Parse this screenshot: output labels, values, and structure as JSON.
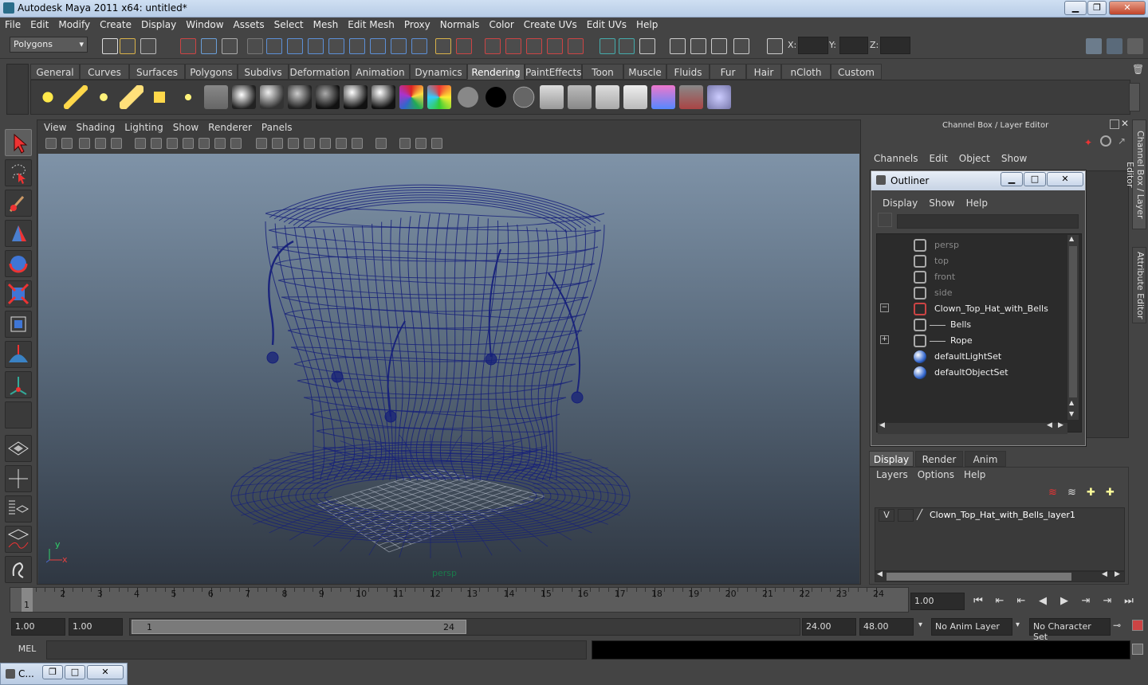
{
  "window": {
    "title": "Autodesk Maya 2011 x64: untitled*",
    "minimize": "▁",
    "maximize": "❐",
    "close": "✕"
  },
  "menubar": [
    "File",
    "Edit",
    "Modify",
    "Create",
    "Display",
    "Window",
    "Assets",
    "Select",
    "Mesh",
    "Edit Mesh",
    "Proxy",
    "Normals",
    "Color",
    "Create UVs",
    "Edit UVs",
    "Help"
  ],
  "statusline": {
    "menuset": "Polygons",
    "x_label": "X:",
    "y_label": "Y:",
    "z_label": "Z:"
  },
  "shelf": {
    "tabs": [
      "General",
      "Curves",
      "Surfaces",
      "Polygons",
      "Subdivs",
      "Deformation",
      "Animation",
      "Dynamics",
      "Rendering",
      "PaintEffects",
      "Toon",
      "Muscle",
      "Fluids",
      "Fur",
      "Hair",
      "nCloth",
      "Custom"
    ],
    "active_tab": "Rendering",
    "icons": [
      "ambient-light-icon",
      "directional-light-icon",
      "point-light-icon",
      "spot-light-icon",
      "area-light-icon",
      "volume-light-icon",
      "camera-icon",
      "anisotropic-shader-icon",
      "blinn-shader-icon",
      "lambert-shader-icon",
      "phong-shader-icon",
      "phonge-shader-icon",
      "ramp-shader-icon",
      "layered-shader-icon",
      "surface-shader-icon",
      "use-background-icon",
      "ocean-shader-icon",
      "clapboard-render-icon",
      "ipr-render-icon",
      "render-settings-icon",
      "hypershade-icon",
      "render-view-icon",
      "batch-render-icon",
      "mental-ray-icon",
      "paint-brush-icon"
    ]
  },
  "viewport": {
    "menus": [
      "View",
      "Shading",
      "Lighting",
      "Show",
      "Renderer",
      "Panels"
    ],
    "camera_label": "persp",
    "axis_y": "y",
    "axis_x": "x",
    "wire_color": "#16207a"
  },
  "channelbox": {
    "title": "Channel Box / Layer Editor",
    "menus": [
      "Channels",
      "Edit",
      "Object",
      "Show"
    ]
  },
  "side_tabs": [
    "Channel Box / Layer Editor",
    "Attribute Editor"
  ],
  "outliner": {
    "title": "Outliner",
    "minimize": "▁",
    "maximize": "□",
    "close": "✕",
    "menus": [
      "Display",
      "Show",
      "Help"
    ],
    "items": [
      {
        "label": "persp",
        "dim": true,
        "icon": "camera-icon",
        "expander": ""
      },
      {
        "label": "top",
        "dim": true,
        "icon": "camera-icon",
        "expander": ""
      },
      {
        "label": "front",
        "dim": true,
        "icon": "camera-icon",
        "expander": ""
      },
      {
        "label": "side",
        "dim": true,
        "icon": "camera-icon",
        "expander": ""
      },
      {
        "label": "Clown_Top_Hat_with_Bells",
        "dim": false,
        "icon": "group-icon",
        "expander": "−"
      },
      {
        "label": "Bells",
        "dim": false,
        "icon": "mesh-icon",
        "expander": ""
      },
      {
        "label": "Rope",
        "dim": false,
        "icon": "mesh-icon",
        "expander": "+"
      },
      {
        "label": "defaultLightSet",
        "dim": false,
        "icon": "set-icon",
        "expander": ""
      },
      {
        "label": "defaultObjectSet",
        "dim": false,
        "icon": "set-icon",
        "expander": ""
      }
    ]
  },
  "layer_editor": {
    "tabs": [
      "Display",
      "Render",
      "Anim"
    ],
    "active_tab": "Display",
    "menus": [
      "Layers",
      "Options",
      "Help"
    ],
    "layer": {
      "visible": "V",
      "name": "Clown_Top_Hat_with_Bells_layer1"
    }
  },
  "timeline": {
    "ticks": [
      "1",
      "2",
      "3",
      "4",
      "5",
      "6",
      "7",
      "8",
      "9",
      "10",
      "11",
      "12",
      "13",
      "14",
      "15",
      "16",
      "17",
      "18",
      "19",
      "20",
      "21",
      "22",
      "23",
      "24"
    ],
    "current_frame_marker": "1",
    "current_time": "1.00"
  },
  "range": {
    "start": "1.00",
    "playback_start": "1.00",
    "slider_start": "1",
    "slider_end": "24",
    "playback_end": "24.00",
    "end": "48.00",
    "anim_layer": "No Anim Layer",
    "character_set": "No Character Set"
  },
  "cmdline": {
    "label": "MEL"
  },
  "taskbar": {
    "label": "C..."
  }
}
